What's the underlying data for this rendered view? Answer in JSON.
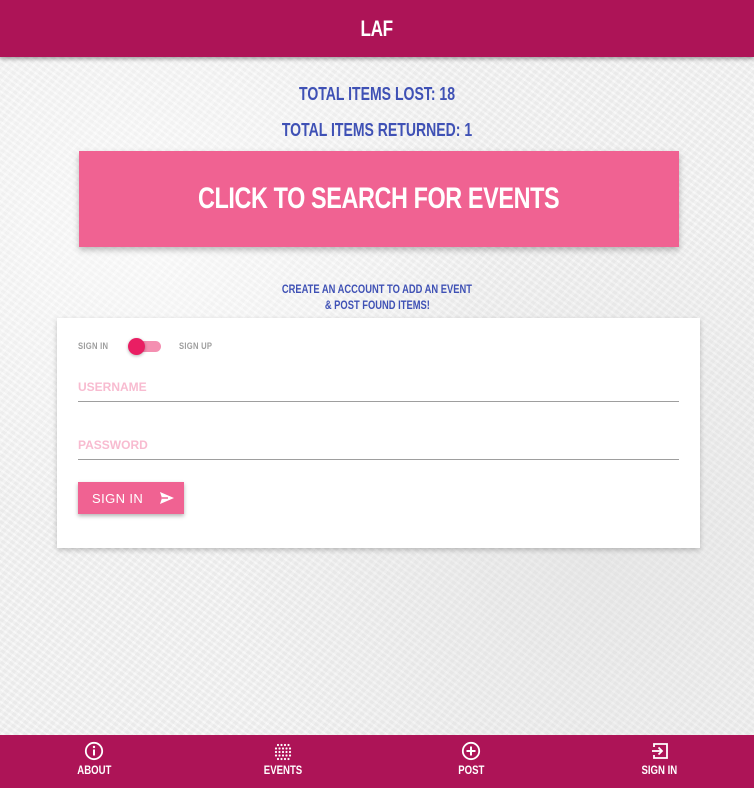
{
  "app": {
    "title": "LAF"
  },
  "stats": {
    "lost_label": "TOTAL ITEMS LOST: 18",
    "returned_label": "TOTAL ITEMS RETURNED: 1"
  },
  "search_banner": {
    "label": "CLICK TO SEARCH FOR EVENTS"
  },
  "cta": {
    "line1": "CREATE AN ACCOUNT TO ADD AN EVENT",
    "line2": "& POST FOUND ITEMS!"
  },
  "auth_form": {
    "toggle": {
      "left_label": "SIGN IN",
      "right_label": "SIGN UP",
      "state": "sign-in"
    },
    "username": {
      "placeholder": "USERNAME",
      "value": ""
    },
    "password": {
      "placeholder": "PASSWORD",
      "value": ""
    },
    "submit_label": "SIGN IN",
    "submit_icon": "send-icon"
  },
  "bottom_nav": {
    "items": [
      {
        "label": "ABOUT",
        "icon": "info-icon"
      },
      {
        "label": "EVENTS",
        "icon": "grid-icon"
      },
      {
        "label": "POST",
        "icon": "add-circle-icon"
      },
      {
        "label": "SIGN IN",
        "icon": "login-icon"
      }
    ]
  },
  "colors": {
    "primary_dark": "#ad1457",
    "accent": "#f06292",
    "switch": "#e91e63",
    "text_blue": "#3f51b5"
  }
}
